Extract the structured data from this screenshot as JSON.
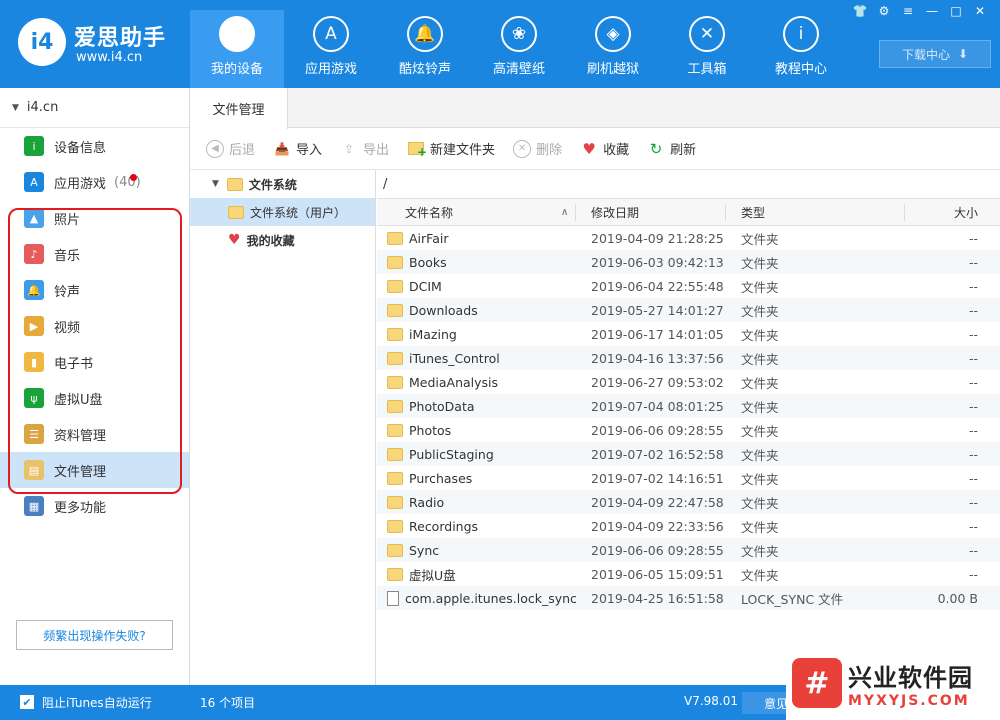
{
  "header": {
    "brand_name": "爱思助手",
    "brand_url": "www.i4.cn",
    "logo_text": "i4",
    "nav": [
      {
        "label": "我的设备",
        "icon": "apple-icon",
        "glyph": ""
      },
      {
        "label": "应用游戏",
        "icon": "app-store-icon",
        "glyph": "A"
      },
      {
        "label": "酷炫铃声",
        "icon": "bell-icon",
        "glyph": "🔔"
      },
      {
        "label": "高清壁纸",
        "icon": "flower-icon",
        "glyph": "❀"
      },
      {
        "label": "刷机越狱",
        "icon": "dropbox-icon",
        "glyph": "◈"
      },
      {
        "label": "工具箱",
        "icon": "tools-icon",
        "glyph": "✕"
      },
      {
        "label": "教程中心",
        "icon": "info-icon",
        "glyph": "i"
      }
    ],
    "download_label": "下载中心",
    "window_controls": [
      "👕",
      "⚙",
      "≡",
      "—",
      "□",
      "✕"
    ]
  },
  "sidebar": {
    "device_name": "i4.cn",
    "items": [
      {
        "label": "设备信息",
        "icon": "info-circle-icon",
        "color": "#19a33a",
        "glyph": "i"
      },
      {
        "label": "应用游戏",
        "icon": "app-store-icon",
        "color": "#1a86e0",
        "glyph": "A",
        "count": "(40)"
      },
      {
        "label": "照片",
        "icon": "photo-icon",
        "color": "#4aa3e8",
        "glyph": "▲"
      },
      {
        "label": "音乐",
        "icon": "music-icon",
        "color": "#e65b5b",
        "glyph": "♪"
      },
      {
        "label": "铃声",
        "icon": "bell-icon",
        "color": "#3d9be9",
        "glyph": "🔔"
      },
      {
        "label": "视频",
        "icon": "video-icon",
        "color": "#e7a93a",
        "glyph": "▶"
      },
      {
        "label": "电子书",
        "icon": "book-icon",
        "color": "#f0b840",
        "glyph": "▮"
      },
      {
        "label": "虚拟U盘",
        "icon": "usb-icon",
        "color": "#19a33a",
        "glyph": "ψ"
      },
      {
        "label": "资料管理",
        "icon": "contacts-icon",
        "color": "#d9a441",
        "glyph": "☰"
      },
      {
        "label": "文件管理",
        "icon": "files-icon",
        "color": "#e8c26a",
        "glyph": "▤"
      },
      {
        "label": "更多功能",
        "icon": "grid-icon",
        "color": "#4a7fc0",
        "glyph": "▦"
      }
    ],
    "active_index": 9,
    "fail_button": "频繁出现操作失败?"
  },
  "tabs": [
    {
      "label": "文件管理"
    }
  ],
  "toolbar": {
    "back": "后退",
    "import": "导入",
    "export": "导出",
    "new_folder": "新建文件夹",
    "delete": "删除",
    "favorite": "收藏",
    "refresh": "刷新"
  },
  "tree": {
    "root": "文件系统",
    "user": "文件系统（用户）",
    "favorites": "我的收藏"
  },
  "path": "/",
  "columns": {
    "name": "文件名称",
    "date": "修改日期",
    "type": "类型",
    "size": "大小"
  },
  "files": [
    {
      "name": "AirFair",
      "date": "2019-04-09 21:28:25",
      "type": "文件夹",
      "size": "--",
      "kind": "folder"
    },
    {
      "name": "Books",
      "date": "2019-06-03 09:42:13",
      "type": "文件夹",
      "size": "--",
      "kind": "folder"
    },
    {
      "name": "DCIM",
      "date": "2019-06-04 22:55:48",
      "type": "文件夹",
      "size": "--",
      "kind": "folder"
    },
    {
      "name": "Downloads",
      "date": "2019-05-27 14:01:27",
      "type": "文件夹",
      "size": "--",
      "kind": "folder"
    },
    {
      "name": "iMazing",
      "date": "2019-06-17 14:01:05",
      "type": "文件夹",
      "size": "--",
      "kind": "folder"
    },
    {
      "name": "iTunes_Control",
      "date": "2019-04-16 13:37:56",
      "type": "文件夹",
      "size": "--",
      "kind": "folder"
    },
    {
      "name": "MediaAnalysis",
      "date": "2019-06-27 09:53:02",
      "type": "文件夹",
      "size": "--",
      "kind": "folder"
    },
    {
      "name": "PhotoData",
      "date": "2019-07-04 08:01:25",
      "type": "文件夹",
      "size": "--",
      "kind": "folder"
    },
    {
      "name": "Photos",
      "date": "2019-06-06 09:28:55",
      "type": "文件夹",
      "size": "--",
      "kind": "folder"
    },
    {
      "name": "PublicStaging",
      "date": "2019-07-02 16:52:58",
      "type": "文件夹",
      "size": "--",
      "kind": "folder"
    },
    {
      "name": "Purchases",
      "date": "2019-07-02 14:16:51",
      "type": "文件夹",
      "size": "--",
      "kind": "folder"
    },
    {
      "name": "Radio",
      "date": "2019-04-09 22:47:58",
      "type": "文件夹",
      "size": "--",
      "kind": "folder"
    },
    {
      "name": "Recordings",
      "date": "2019-04-09 22:33:56",
      "type": "文件夹",
      "size": "--",
      "kind": "folder"
    },
    {
      "name": "Sync",
      "date": "2019-06-06 09:28:55",
      "type": "文件夹",
      "size": "--",
      "kind": "folder"
    },
    {
      "name": "虚拟U盘",
      "date": "2019-06-05 15:09:51",
      "type": "文件夹",
      "size": "--",
      "kind": "folder"
    },
    {
      "name": "com.apple.itunes.lock_sync",
      "date": "2019-04-25 16:51:58",
      "type": "LOCK_SYNC 文件",
      "size": "0.00 B",
      "kind": "file"
    }
  ],
  "status": {
    "itunes_label": "阻止iTunes自动运行",
    "count": "16 个项目",
    "version": "V7.98.01",
    "feedback": "意见反"
  },
  "watermark": {
    "title": "兴业软件园",
    "url": "MYXYJS.COM",
    "logo": "#"
  },
  "colors": {
    "primary": "#1a86e0",
    "highlight": "#e01d1d",
    "selection": "#cde3f8"
  }
}
